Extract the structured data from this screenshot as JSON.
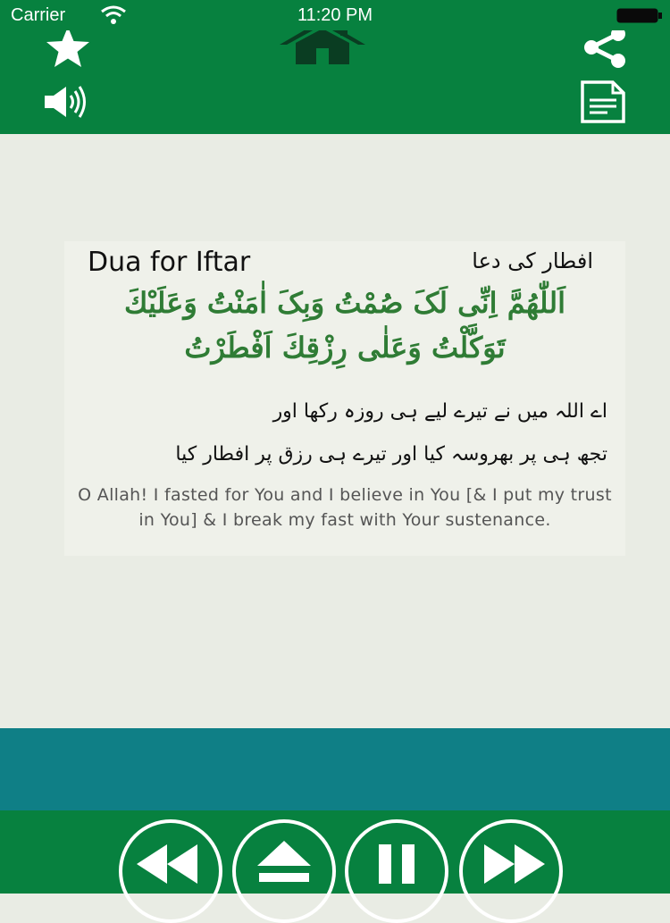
{
  "status_bar": {
    "carrier": "Carrier",
    "time": "11:20 PM"
  },
  "top_bar": {
    "icons": [
      "star-icon",
      "home-icon",
      "share-icon",
      "speaker-icon",
      "document-icon"
    ]
  },
  "dua": {
    "title": "Dua for Iftar",
    "title_urdu": "افطار کی دعا",
    "arabic_line1": "اَللّٰهُمَّ اِنِّی لَکَ صُمْتُ وَبِکَ اٰمَنْتُ وَعَلَيْكَ",
    "arabic_line2": "تَوَکَّلْتُ وَعَلٰی رِزْقِكَ اَفْطَرْتُ",
    "urdu_line1": "اے اللہ میں نے تیرے لیے ہی روزہ رکھا اور",
    "urdu_line2": "تجھ ہی پر بھروسہ کیا اور تیرے ہی رزق پر افطار کیا",
    "english": "O Allah! I fasted for You and I believe in You [& I put my trust in You] & I break my fast with Your sustenance."
  },
  "player": {
    "controls": [
      "rewind-icon",
      "eject-icon",
      "pause-icon",
      "fast-forward-icon"
    ]
  },
  "colors": {
    "primary_green": "#07813f",
    "teal": "#0f7f86",
    "background": "#e9ece4",
    "arabic_text": "#2f7c35"
  }
}
